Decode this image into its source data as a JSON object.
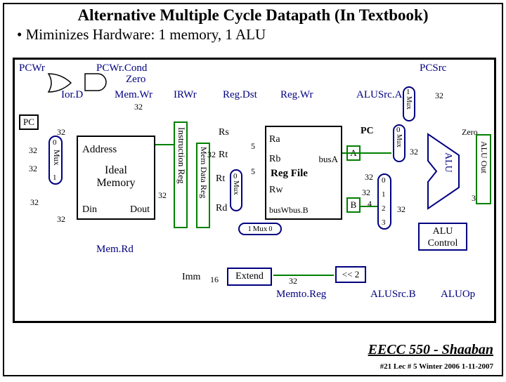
{
  "title": "Alternative Multiple Cycle Datapath (In Textbook)",
  "bullet": "•   Miminizes Hardware: 1 memory, 1 ALU",
  "ctl": {
    "pcwr": "PCWr",
    "pcwrcond": "PCWr.Cond",
    "zero": "Zero",
    "iord": "Ior.D",
    "memwr": "Mem.Wr",
    "irwr": "IRWr",
    "regdst": "Reg.Dst",
    "regwr": "Reg.Wr",
    "pcsrc": "PCSrc",
    "alusrca": "ALUSrc.A",
    "memrd": "Mem.Rd",
    "memtoreg": "Memto.Reg",
    "alusrcb": "ALUSrc.B",
    "aluop": "ALUOp"
  },
  "blocks": {
    "pc": "PC",
    "address": "Address",
    "idealmem1": "Ideal",
    "idealmem2": "Memory",
    "din": "Din",
    "dout": "Dout",
    "ireg": "Instruction Reg",
    "mdr": "Mem Data Reg",
    "ra": "Ra",
    "rb": "Rb",
    "rw": "Rw",
    "regfile": "Reg File",
    "busA": "busA",
    "busWB": "busWbus.B",
    "pcreg": "PC",
    "extend": "Extend",
    "shl2": "<< 2",
    "alu": "ALU",
    "aluout": "ALU Out",
    "aluctrl1": "ALU",
    "aluctrl2": "Control",
    "zero_wire": "Zero"
  },
  "sig": {
    "rs": "Rs",
    "rt": "Rt",
    "rt2": "Rt",
    "rd": "Rd",
    "imm": "Imm",
    "b16": "16",
    "b5a": "5",
    "b5b": "5",
    "a_lbl": "A",
    "b_lbl": "B"
  },
  "mux": {
    "m01": "Mux",
    "m10": "Mux",
    "n0": "0",
    "n1": "1",
    "n2": "2",
    "n3": "3",
    "n4": "4"
  },
  "bus": {
    "b32": "32"
  },
  "footer1": "EECC 550 - Shaaban",
  "footer2": "#21   Lec # 5  Winter 2006  1-11-2007"
}
